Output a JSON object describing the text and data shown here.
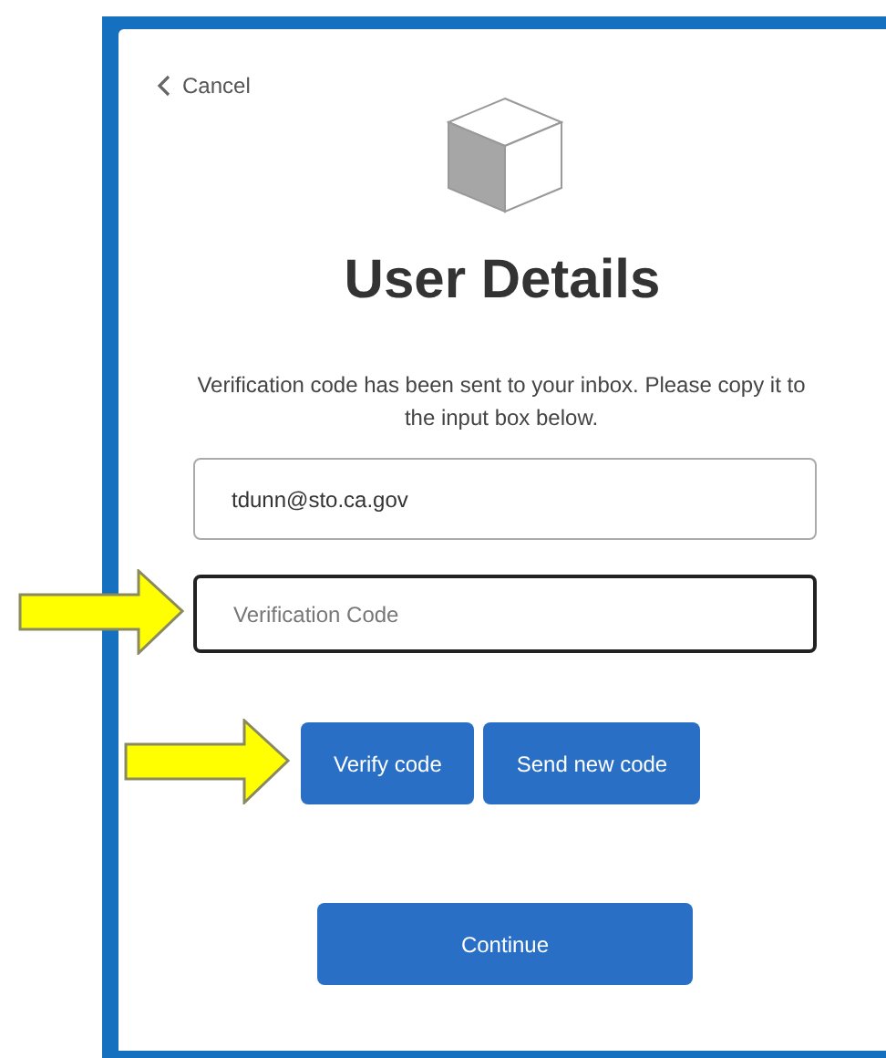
{
  "cancel_link": "Cancel",
  "title": "User Details",
  "message": "Verification code has been sent to your inbox. Please copy it to the input box below.",
  "email_field": {
    "value": "tdunn@sto.ca.gov",
    "focused": false
  },
  "code_field": {
    "placeholder": "Verification Code",
    "focused": true
  },
  "buttons": [
    "Verify code",
    "Send new code"
  ],
  "continue_button": "Continue"
}
